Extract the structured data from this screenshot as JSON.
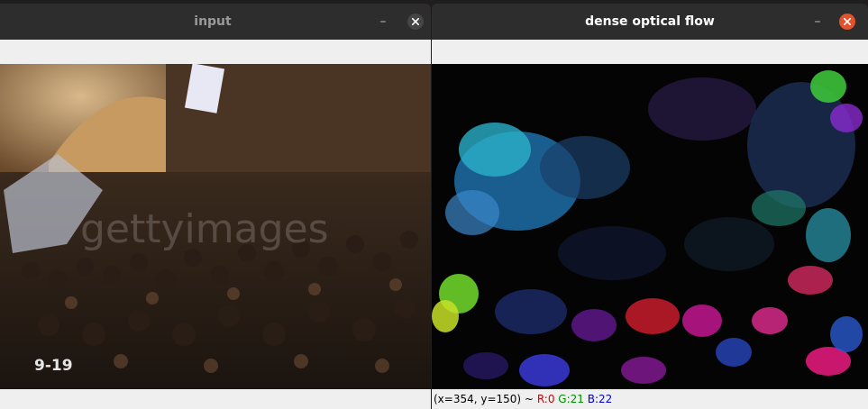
{
  "windows": {
    "input": {
      "title": "input",
      "frame_label": "9-19",
      "watermark": "gettyimages",
      "minimize_glyph": "–"
    },
    "flow": {
      "title": "dense optical flow",
      "minimize_glyph": "–",
      "status": {
        "coords": "(x=354, y=150) ~",
        "r": "R:0",
        "g": "G:21",
        "b": "B:22"
      }
    }
  },
  "icons": {
    "close": "close-icon",
    "minimize": "minimize-icon"
  },
  "colors": {
    "titlebar": "#2d2d2d",
    "close_active": "#e2532d",
    "close_inactive": "#454545",
    "panel": "#efefef"
  }
}
